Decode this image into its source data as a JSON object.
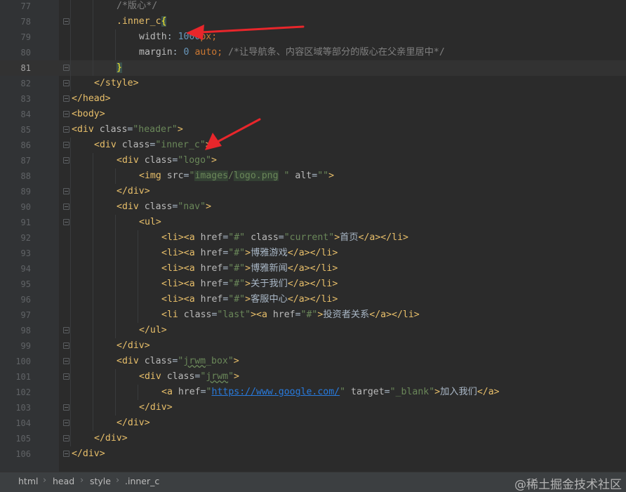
{
  "editor": {
    "lines": [
      {
        "n": "77",
        "fold": false,
        "tokens": [
          {
            "c": "t-comment",
            "t": "/*版心*/"
          }
        ]
      },
      {
        "n": "78",
        "fold": true,
        "tokens": [
          {
            "c": "t-sel",
            "t": ".inner_c"
          },
          {
            "c": "t-brace",
            "t": "{"
          }
        ]
      },
      {
        "n": "79",
        "fold": false,
        "tokens": [
          {
            "c": "t-prop",
            "t": "width"
          },
          {
            "c": "t-text",
            "t": ": "
          },
          {
            "c": "t-num",
            "t": "1000"
          },
          {
            "c": "t-kw",
            "t": "px"
          },
          {
            "c": "t-kw",
            "t": ";"
          }
        ]
      },
      {
        "n": "80",
        "fold": false,
        "tokens": [
          {
            "c": "t-prop",
            "t": "margin"
          },
          {
            "c": "t-text",
            "t": ": "
          },
          {
            "c": "t-num",
            "t": "0"
          },
          {
            "c": "t-text",
            "t": " "
          },
          {
            "c": "t-kw",
            "t": "auto"
          },
          {
            "c": "t-kw",
            "t": ";"
          },
          {
            "c": "t-text",
            "t": " "
          },
          {
            "c": "t-comment",
            "t": "/*让导航条、内容区域等部分的版心在父亲里居中*/"
          }
        ]
      },
      {
        "n": "81",
        "fold": true,
        "cur": true,
        "tokens": [
          {
            "c": "t-brace",
            "t": "}"
          }
        ]
      },
      {
        "n": "82",
        "fold": true,
        "tokens": [
          {
            "c": "t-tag",
            "t": "</style>"
          }
        ]
      },
      {
        "n": "83",
        "fold": true,
        "tokens": [
          {
            "c": "t-tag",
            "t": "</head>"
          }
        ]
      },
      {
        "n": "84",
        "fold": true,
        "tokens": [
          {
            "c": "t-tag",
            "t": "<body>"
          }
        ]
      },
      {
        "n": "85",
        "fold": true,
        "tokens": [
          {
            "c": "t-tag",
            "t": "<div "
          },
          {
            "c": "t-attr",
            "t": "class"
          },
          {
            "c": "t-text",
            "t": "="
          },
          {
            "c": "t-str",
            "t": "\"header\""
          },
          {
            "c": "t-tag",
            "t": ">"
          }
        ]
      },
      {
        "n": "86",
        "fold": true,
        "tokens": [
          {
            "c": "t-tag",
            "t": "<div "
          },
          {
            "c": "t-attr",
            "t": "class"
          },
          {
            "c": "t-text",
            "t": "="
          },
          {
            "c": "t-str",
            "t": "\"inner_c\""
          },
          {
            "c": "t-tag",
            "t": ">"
          }
        ]
      },
      {
        "n": "87",
        "fold": true,
        "tokens": [
          {
            "c": "t-tag",
            "t": "<div "
          },
          {
            "c": "t-attr",
            "t": "class"
          },
          {
            "c": "t-text",
            "t": "="
          },
          {
            "c": "t-str",
            "t": "\"logo\""
          },
          {
            "c": "t-tag",
            "t": ">"
          }
        ]
      },
      {
        "n": "88",
        "fold": false,
        "tokens": [
          {
            "c": "t-tag",
            "t": "<img "
          },
          {
            "c": "t-attr",
            "t": "src"
          },
          {
            "c": "t-text",
            "t": "="
          },
          {
            "c": "t-str",
            "t": "\""
          },
          {
            "c": "t-str t-hl",
            "t": "images"
          },
          {
            "c": "t-str",
            "t": "/"
          },
          {
            "c": "t-str t-hl",
            "t": "logo.png"
          },
          {
            "c": "t-str",
            "t": " \""
          },
          {
            "c": "t-text",
            "t": " "
          },
          {
            "c": "t-attr",
            "t": "alt"
          },
          {
            "c": "t-text",
            "t": "="
          },
          {
            "c": "t-str",
            "t": "\"\""
          },
          {
            "c": "t-tag",
            "t": ">"
          }
        ]
      },
      {
        "n": "89",
        "fold": true,
        "tokens": [
          {
            "c": "t-tag",
            "t": "</div>"
          }
        ]
      },
      {
        "n": "90",
        "fold": true,
        "tokens": [
          {
            "c": "t-tag",
            "t": "<div "
          },
          {
            "c": "t-attr",
            "t": "class"
          },
          {
            "c": "t-text",
            "t": "="
          },
          {
            "c": "t-str",
            "t": "\"nav\""
          },
          {
            "c": "t-tag",
            "t": ">"
          }
        ]
      },
      {
        "n": "91",
        "fold": true,
        "tokens": [
          {
            "c": "t-tag",
            "t": "<ul>"
          }
        ]
      },
      {
        "n": "92",
        "fold": false,
        "tokens": [
          {
            "c": "t-tag",
            "t": "<li><a "
          },
          {
            "c": "t-attr",
            "t": "href"
          },
          {
            "c": "t-text",
            "t": "="
          },
          {
            "c": "t-str",
            "t": "\"#\""
          },
          {
            "c": "t-text",
            "t": " "
          },
          {
            "c": "t-attr",
            "t": "class"
          },
          {
            "c": "t-text",
            "t": "="
          },
          {
            "c": "t-str",
            "t": "\"current\""
          },
          {
            "c": "t-tag",
            "t": ">"
          },
          {
            "c": "t-text",
            "t": "首页"
          },
          {
            "c": "t-tag",
            "t": "</a></li>"
          }
        ]
      },
      {
        "n": "93",
        "fold": false,
        "tokens": [
          {
            "c": "t-tag",
            "t": "<li><a "
          },
          {
            "c": "t-attr",
            "t": "href"
          },
          {
            "c": "t-text",
            "t": "="
          },
          {
            "c": "t-str",
            "t": "\"#\""
          },
          {
            "c": "t-tag",
            "t": ">"
          },
          {
            "c": "t-text",
            "t": "博雅游戏"
          },
          {
            "c": "t-tag",
            "t": "</a></li>"
          }
        ]
      },
      {
        "n": "94",
        "fold": false,
        "tokens": [
          {
            "c": "t-tag",
            "t": "<li><a "
          },
          {
            "c": "t-attr",
            "t": "href"
          },
          {
            "c": "t-text",
            "t": "="
          },
          {
            "c": "t-str",
            "t": "\"#\""
          },
          {
            "c": "t-tag",
            "t": ">"
          },
          {
            "c": "t-text",
            "t": "博雅新闻"
          },
          {
            "c": "t-tag",
            "t": "</a></li>"
          }
        ]
      },
      {
        "n": "95",
        "fold": false,
        "tokens": [
          {
            "c": "t-tag",
            "t": "<li><a "
          },
          {
            "c": "t-attr",
            "t": "href"
          },
          {
            "c": "t-text",
            "t": "="
          },
          {
            "c": "t-str",
            "t": "\"#\""
          },
          {
            "c": "t-tag",
            "t": ">"
          },
          {
            "c": "t-text",
            "t": "关于我们"
          },
          {
            "c": "t-tag",
            "t": "</a></li>"
          }
        ]
      },
      {
        "n": "96",
        "fold": false,
        "tokens": [
          {
            "c": "t-tag",
            "t": "<li><a "
          },
          {
            "c": "t-attr",
            "t": "href"
          },
          {
            "c": "t-text",
            "t": "="
          },
          {
            "c": "t-str",
            "t": "\"#\""
          },
          {
            "c": "t-tag",
            "t": ">"
          },
          {
            "c": "t-text",
            "t": "客服中心"
          },
          {
            "c": "t-tag",
            "t": "</a></li>"
          }
        ]
      },
      {
        "n": "97",
        "fold": false,
        "tokens": [
          {
            "c": "t-tag",
            "t": "<li "
          },
          {
            "c": "t-attr",
            "t": "class"
          },
          {
            "c": "t-text",
            "t": "="
          },
          {
            "c": "t-str",
            "t": "\"last\""
          },
          {
            "c": "t-tag",
            "t": "><a "
          },
          {
            "c": "t-attr",
            "t": "href"
          },
          {
            "c": "t-text",
            "t": "="
          },
          {
            "c": "t-str",
            "t": "\"#\""
          },
          {
            "c": "t-tag",
            "t": ">"
          },
          {
            "c": "t-text",
            "t": "投资者关系"
          },
          {
            "c": "t-tag",
            "t": "</a></li>"
          }
        ]
      },
      {
        "n": "98",
        "fold": true,
        "tokens": [
          {
            "c": "t-tag",
            "t": "</ul>"
          }
        ]
      },
      {
        "n": "99",
        "fold": true,
        "tokens": [
          {
            "c": "t-tag",
            "t": "</div>"
          }
        ]
      },
      {
        "n": "100",
        "fold": true,
        "tokens": [
          {
            "c": "t-tag",
            "t": "<div "
          },
          {
            "c": "t-attr",
            "t": "class"
          },
          {
            "c": "t-text",
            "t": "="
          },
          {
            "c": "t-str",
            "t": "\""
          },
          {
            "c": "t-str t-wavy",
            "t": "jrwm"
          },
          {
            "c": "t-str",
            "t": "_box\""
          },
          {
            "c": "t-tag",
            "t": ">"
          }
        ]
      },
      {
        "n": "101",
        "fold": true,
        "tokens": [
          {
            "c": "t-tag",
            "t": "<div "
          },
          {
            "c": "t-attr",
            "t": "class"
          },
          {
            "c": "t-text",
            "t": "="
          },
          {
            "c": "t-str",
            "t": "\""
          },
          {
            "c": "t-str t-wavy",
            "t": "jrwm"
          },
          {
            "c": "t-str",
            "t": "\""
          },
          {
            "c": "t-tag",
            "t": ">"
          }
        ]
      },
      {
        "n": "102",
        "fold": false,
        "tokens": [
          {
            "c": "t-tag",
            "t": "<a "
          },
          {
            "c": "t-attr",
            "t": "href"
          },
          {
            "c": "t-text",
            "t": "="
          },
          {
            "c": "t-str",
            "t": "\""
          },
          {
            "c": "t-link",
            "t": "https://www.google.com/"
          },
          {
            "c": "t-str",
            "t": "\""
          },
          {
            "c": "t-text",
            "t": " "
          },
          {
            "c": "t-attr",
            "t": "target"
          },
          {
            "c": "t-text",
            "t": "="
          },
          {
            "c": "t-str",
            "t": "\"_blank\""
          },
          {
            "c": "t-tag",
            "t": ">"
          },
          {
            "c": "t-text",
            "t": "加入我们"
          },
          {
            "c": "t-tag",
            "t": "</a>"
          }
        ]
      },
      {
        "n": "103",
        "fold": true,
        "tokens": [
          {
            "c": "t-tag",
            "t": "</div>"
          }
        ]
      },
      {
        "n": "104",
        "fold": true,
        "tokens": [
          {
            "c": "t-tag",
            "t": "</div>"
          }
        ]
      },
      {
        "n": "105",
        "fold": true,
        "tokens": [
          {
            "c": "t-tag",
            "t": "</div>"
          }
        ]
      },
      {
        "n": "106",
        "fold": true,
        "tokens": [
          {
            "c": "t-tag",
            "t": "</div>"
          }
        ]
      }
    ]
  },
  "statusbar": {
    "breadcrumbs": [
      "html",
      "head",
      "style",
      ".inner_c"
    ]
  },
  "watermark": "@稀土掘金技术社区",
  "colors": {
    "annotation_arrow": "#e8262b"
  }
}
